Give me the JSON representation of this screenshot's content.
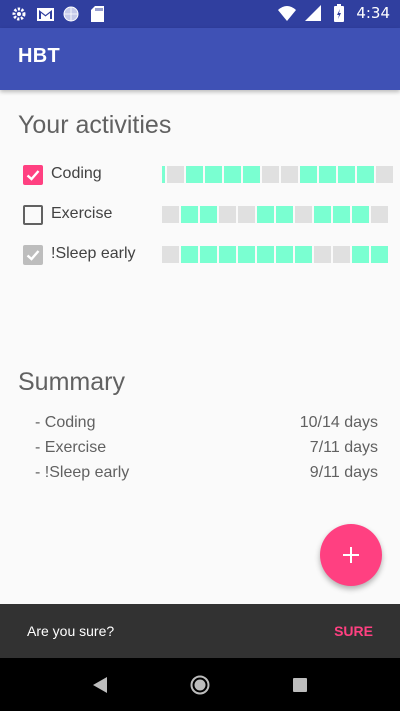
{
  "status_bar": {
    "time": "4:34",
    "left_icons": [
      "gear-icon",
      "gmail-icon",
      "globe-icon",
      "sd-card-icon"
    ],
    "right_icons": [
      "wifi-icon",
      "signal-icon",
      "battery-icon"
    ]
  },
  "app_bar": {
    "title": "HBT"
  },
  "activities_section": {
    "title": "Your activities"
  },
  "activities": [
    {
      "label": "Coding",
      "state": "checked",
      "history": [
        1,
        0,
        1,
        1,
        1,
        1,
        0,
        0,
        1,
        1,
        1,
        1,
        0
      ]
    },
    {
      "label": "Exercise",
      "state": "unchecked",
      "history": [
        0,
        1,
        1,
        0,
        0,
        1,
        1,
        0,
        1,
        1,
        1,
        0
      ]
    },
    {
      "label": "!Sleep early",
      "state": "disabled",
      "history": [
        0,
        1,
        1,
        1,
        1,
        1,
        1,
        1,
        0,
        0,
        1,
        1
      ]
    }
  ],
  "summary_section": {
    "title": "Summary"
  },
  "summary": [
    {
      "name": "- Coding",
      "days": "10/14 days"
    },
    {
      "name": "- Exercise",
      "days": "7/11 days"
    },
    {
      "name": "- !Sleep early",
      "days": "9/11 days"
    }
  ],
  "fab": {
    "icon": "plus-icon"
  },
  "snackbar": {
    "message": "Are you sure?",
    "action": "SURE"
  },
  "nav_bar": {
    "icons": [
      "back-icon",
      "home-icon",
      "recents-icon"
    ]
  },
  "colors": {
    "primary": "#3f51b5",
    "primary_dark": "#303f9f",
    "accent": "#ff4081",
    "history_on": "#7affd1",
    "history_off": "#e0e0e0"
  }
}
